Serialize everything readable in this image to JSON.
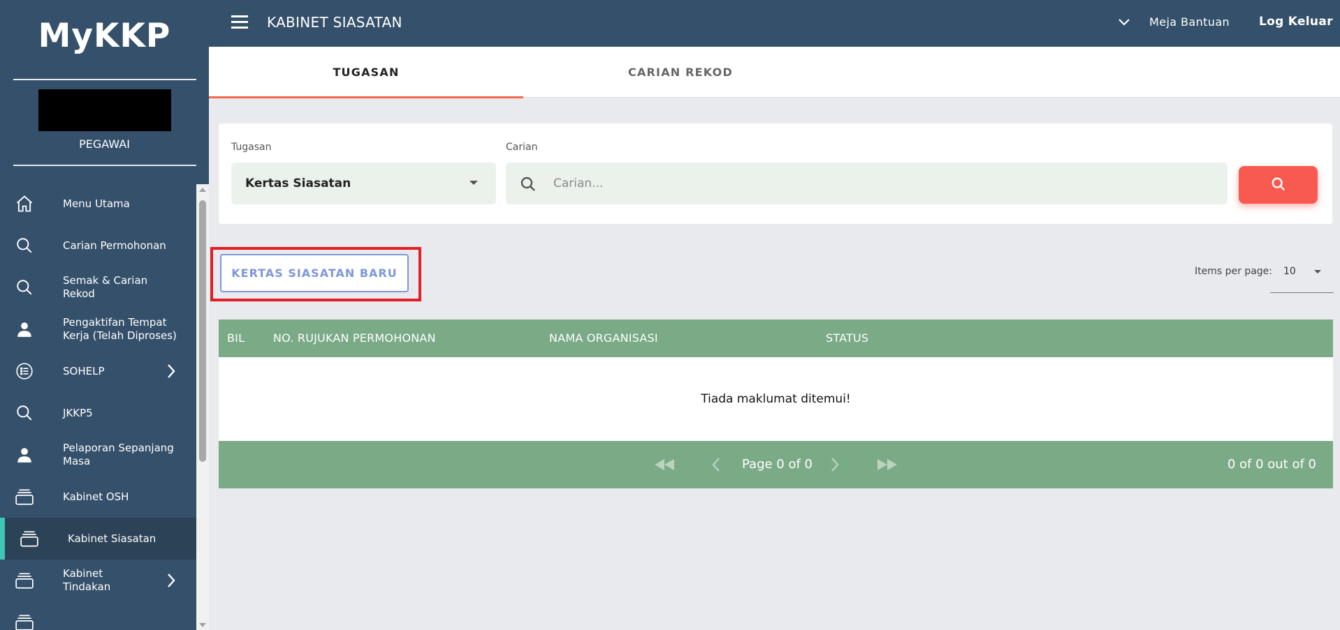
{
  "app": {
    "brand": "MyKKP",
    "user_role": "PEGAWAI"
  },
  "topbar": {
    "title": "KABINET SIASATAN",
    "help": "Meja Bantuan",
    "logout": "Log Keluar"
  },
  "sidebar": {
    "items": [
      {
        "label": "Menu Utama",
        "icon": "home-icon"
      },
      {
        "label": "Carian Permohonan",
        "icon": "search-icon"
      },
      {
        "label": "Semak & Carian Rekod",
        "icon": "search-icon"
      },
      {
        "label": "Pengaktifan Tempat Kerja (Telah Diproses)",
        "icon": "person-icon"
      },
      {
        "label": "SOHELP",
        "icon": "list-icon",
        "expandable": true
      },
      {
        "label": "JKKP5",
        "icon": "search-icon"
      },
      {
        "label": "Pelaporan Sepanjang Masa",
        "icon": "person-icon"
      },
      {
        "label": "Kabinet OSH",
        "icon": "cabinet-icon"
      },
      {
        "label": "Kabinet Siasatan",
        "icon": "cabinet-icon",
        "active": true
      },
      {
        "label": "Kabinet Tindakan",
        "icon": "cabinet-icon",
        "expandable": true
      }
    ]
  },
  "tabs": [
    {
      "label": "TUGASAN",
      "active": true
    },
    {
      "label": "CARIAN REKOD",
      "active": false
    }
  ],
  "filters": {
    "task_label": "Tugasan",
    "task_value": "Kertas Siasatan",
    "search_label": "Carian",
    "search_placeholder": "Carian...",
    "search_value": ""
  },
  "actions": {
    "new_button": "KERTAS SIASATAN BARU",
    "items_per_page_label": "Items per page:",
    "items_per_page_value": "10"
  },
  "table": {
    "columns": [
      "BIL",
      "NO. RUJUKAN PERMOHONAN",
      "NAMA ORGANISASI",
      "STATUS"
    ],
    "rows": [],
    "empty_message": "Tiada maklumat ditemui!"
  },
  "pagination": {
    "page_text": "Page 0 of 0",
    "count_text": "0 of 0 out of 0"
  },
  "colors": {
    "sidebar_bg": "#35506a",
    "accent_tab": "#f26b4f",
    "table_green": "#7baa87",
    "search_button": "#f95a50",
    "highlight_red": "#e21f26"
  }
}
